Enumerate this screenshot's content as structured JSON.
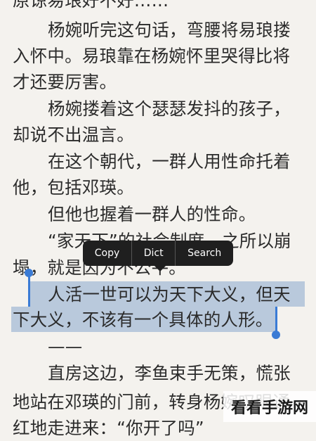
{
  "reader": {
    "lines": [
      "原谅易琅好不好……”",
      "杨婉听完这句话，弯腰将易琅搂",
      "入怀中。易琅靠在杨婉怀里哭得比将",
      "才还要厉害。",
      "杨婉搂着这个瑟瑟发抖的孩子，",
      "却说不出温言。",
      "在这个朝代，一群人用性命托着",
      "他，包括邓瑛。",
      "但他也握着一群人的性命。",
      "“家天下”的社会制度，之所以崩",
      "塌，就是因为不公平。",
      "人活一世可以为天下大义，但天",
      "下大义，不该有一个具体的人形。",
      "——",
      "直房这边，李鱼束手无策，慌张",
      "地站在邓瑛的门前，转身杨婉叹眼通",
      "红地走进来：“你开了吗”"
    ]
  },
  "menu": {
    "copy": "Copy",
    "dict": "Dict",
    "search": "Search"
  },
  "watermark": {
    "text": "看看手游网"
  },
  "colors": {
    "background": "#f4f2ee",
    "selection": "#b9c9dc",
    "handle": "#3a7bd5",
    "menu": "#1f1f1f"
  }
}
